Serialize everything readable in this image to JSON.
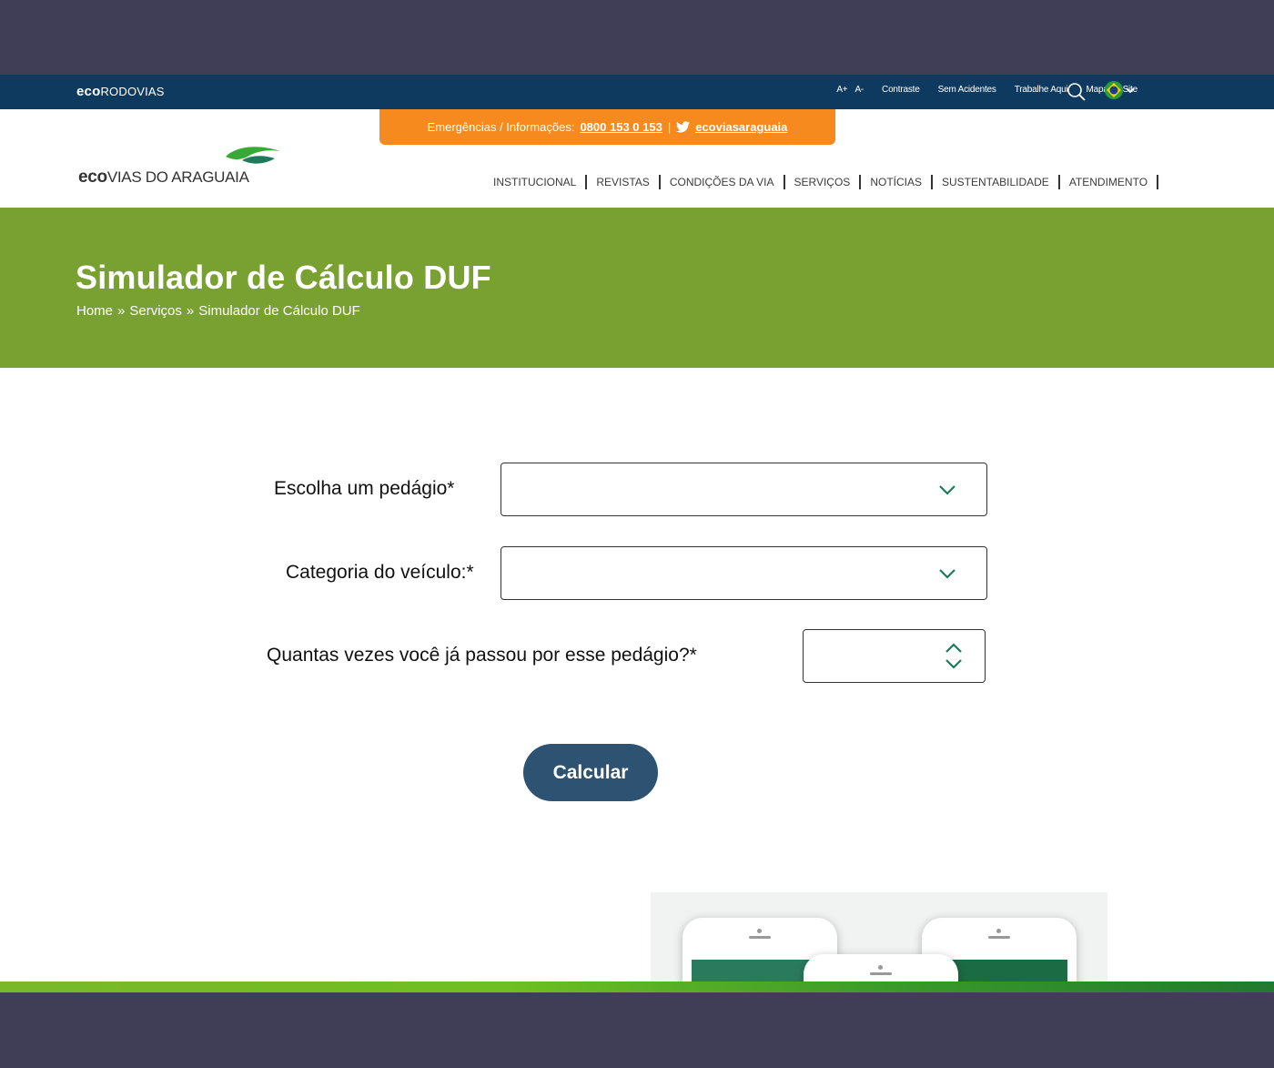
{
  "topbar": {
    "brand_bold": "eco",
    "brand_rest": "RODOVIAS",
    "font_plus": "A+",
    "font_minus": "A-",
    "links": [
      "Contraste",
      "Sem Acidentes",
      "Trabalhe Aqui",
      "Mapa do Site"
    ]
  },
  "header": {
    "emergency_label": "Emergências / Informações:",
    "emergency_phone": "0800 153 0 153",
    "separator": "|",
    "twitter_handle": "ecoviasaraguaia",
    "logo_bold": "eco",
    "logo_rest": "VIAS DO ARAGUAIA",
    "nav": [
      "INSTITUCIONAL",
      "REVISTAS",
      "CONDIÇÕES DA VIA",
      "SERVIÇOS",
      "NOTÍCIAS",
      "SUSTENTABILIDADE",
      "ATENDIMENTO"
    ]
  },
  "hero": {
    "title": "Simulador de Cálculo DUF",
    "breadcrumb": [
      "Home",
      "»",
      "Serviços",
      "»",
      "Simulador de Cálculo DUF"
    ]
  },
  "form": {
    "toll_label": "Escolha um pedágio*",
    "toll_value": "",
    "category_label": "Categoria do veículo:*",
    "category_value": "",
    "count_label": "Quantas vezes você já passou por esse pedágio?*",
    "count_value": "",
    "submit_label": "Calcular"
  },
  "colors": {
    "topbar": "#0f3a5f",
    "emergency": "#f78a1e",
    "hero": "#79a132",
    "button": "#2d5272",
    "chevron": "#1e7a5a"
  }
}
